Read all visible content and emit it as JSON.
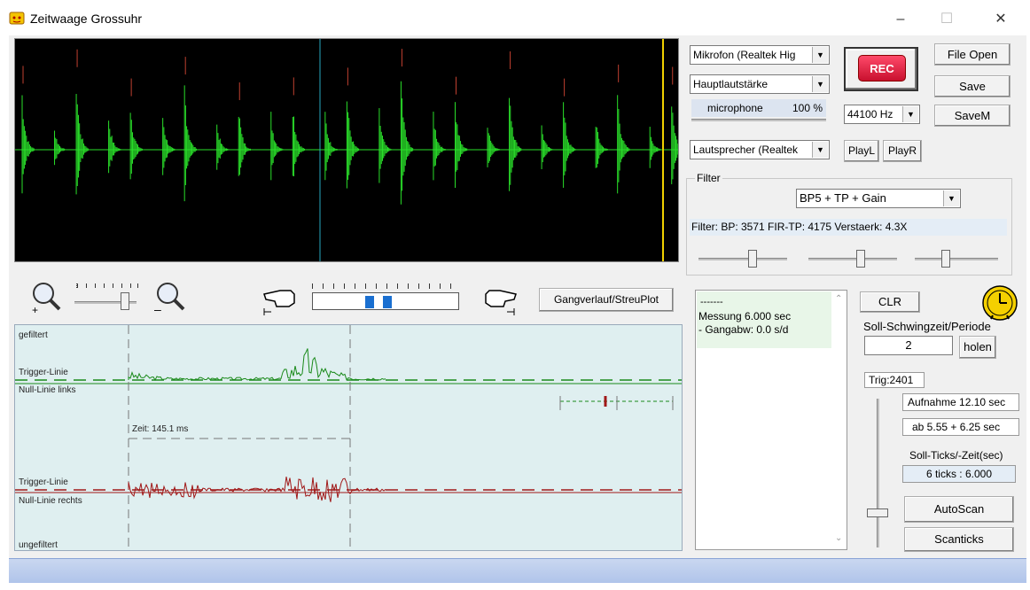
{
  "window": {
    "title": "Zeitwaage Grossuhr",
    "minimize": "–",
    "maximize": "☐",
    "close": "✕"
  },
  "audio": {
    "input_device": "Mikrofon (Realtek Hig",
    "input_channel": "Hauptlautstärke",
    "mic_label": "microphone",
    "mic_level": "100 %",
    "output_device": "Lautsprecher (Realtek",
    "sample_rate": "44100 Hz"
  },
  "buttons": {
    "rec": "REC",
    "file_open": "File Open",
    "save": "Save",
    "save_m": "SaveM",
    "play_l": "PlayL",
    "play_r": "PlayR",
    "gang": "Gangverlauf/StreuPlot",
    "clr": "CLR",
    "holen": "holen",
    "autoscan": "AutoScan",
    "scanticks": "Scanticks"
  },
  "filter": {
    "group_label": "Filter",
    "preset": "BP5 + TP + Gain",
    "info": "Filter: BP: 3571   FIR-TP: 4175    Verstaerk: 4.3X"
  },
  "plot": {
    "labels": {
      "gefiltert": "gefiltert",
      "trigger1": "Trigger-Linie",
      "null_links": "Null-Linie links",
      "zeit": "Zeit: 145.1 ms",
      "trigger2": "Trigger-Linie",
      "null_rechts": "Null-Linie rechts",
      "ungefiltert": "ungefiltert"
    }
  },
  "memo": {
    "lines": [
      "-------",
      "Messung 6.000 sec",
      "- Gangabw: 0.0 s/d"
    ]
  },
  "right_panel": {
    "soll_label": "Soll-Schwingzeit/Periode",
    "soll_value": "2",
    "trig": "Trig:2401",
    "aufnahme": "Aufnahme 12.10 sec",
    "ab": "ab 5.55 + 6.25 sec",
    "soll_ticks_label": "Soll-Ticks/-Zeit(sec)",
    "soll_ticks_value": "6 ticks : 6.000"
  },
  "colors": {
    "signal": "#2adf2a",
    "plot_green": "#1a8a1a",
    "plot_red": "#a01818",
    "cursor_cyan": "#29a8c0",
    "cursor_yellow": "#f0d000"
  }
}
